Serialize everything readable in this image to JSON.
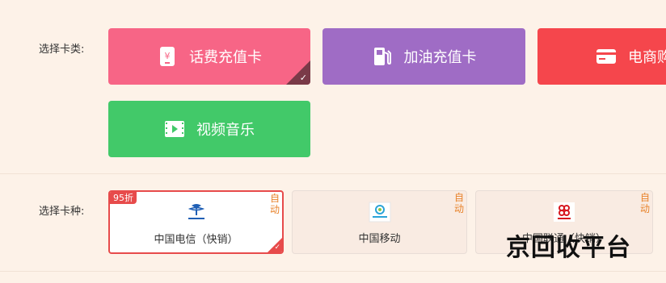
{
  "card_type": {
    "label": "选择卡类:",
    "options": [
      {
        "label": "话费充值卡",
        "color": "#f76586",
        "icon": "phone-card-icon",
        "selected": true
      },
      {
        "label": "加油充值卡",
        "color": "#9f6cc5",
        "icon": "fuel-pump-icon",
        "selected": false
      },
      {
        "label": "电商购",
        "color": "#f5464c",
        "icon": "credit-card-icon",
        "selected": false
      },
      {
        "label": "视频音乐",
        "color": "#42c969",
        "icon": "video-play-icon",
        "selected": false
      }
    ]
  },
  "card_kind": {
    "label": "选择卡种:",
    "options": [
      {
        "name": "中国电信（快销）",
        "auto": "自动",
        "discount": "95折",
        "selected": true,
        "icon": "china-telecom-logo"
      },
      {
        "name": "中国移动",
        "auto": "自动",
        "selected": false,
        "icon": "china-mobile-logo"
      },
      {
        "name": "中国联通（快销）",
        "auto": "自动",
        "selected": false,
        "icon": "china-unicom-logo"
      }
    ]
  },
  "watermark": {
    "text": "京回收平台"
  }
}
